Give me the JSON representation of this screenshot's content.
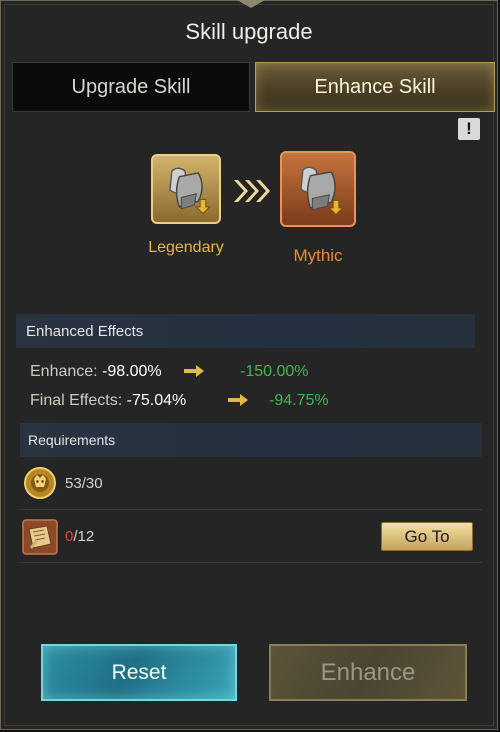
{
  "title": "Skill upgrade",
  "tabs": {
    "upgrade": "Upgrade Skill",
    "enhance": "Enhance Skill",
    "active": "enhance"
  },
  "info_button": "!",
  "skill": {
    "from_rarity": "Legendary",
    "to_rarity": "Mythic",
    "from_icon": "armor-shield-icon",
    "to_icon": "armor-shield-icon",
    "colors": {
      "legendary": "#e7b53c",
      "mythic": "#ef8a2f"
    }
  },
  "effects": {
    "header": "Enhanced Effects",
    "rows": [
      {
        "label": "Enhance:",
        "current": "-98.00%",
        "new": "-150.00%"
      },
      {
        "label": "Final Effects:",
        "current": "-75.04%",
        "new": "-94.75%"
      }
    ],
    "new_value_color": "#3fb84c"
  },
  "requirements": {
    "header": "Requirements",
    "items": [
      {
        "icon": "golden-lion-emblem-icon",
        "have": "53",
        "need": "30",
        "separator": "/"
      },
      {
        "icon": "skill-book-icon",
        "have": "0",
        "need": "12",
        "separator": "/",
        "action": "Go To"
      }
    ]
  },
  "buttons": {
    "reset": "Reset",
    "enhance": "Enhance"
  }
}
